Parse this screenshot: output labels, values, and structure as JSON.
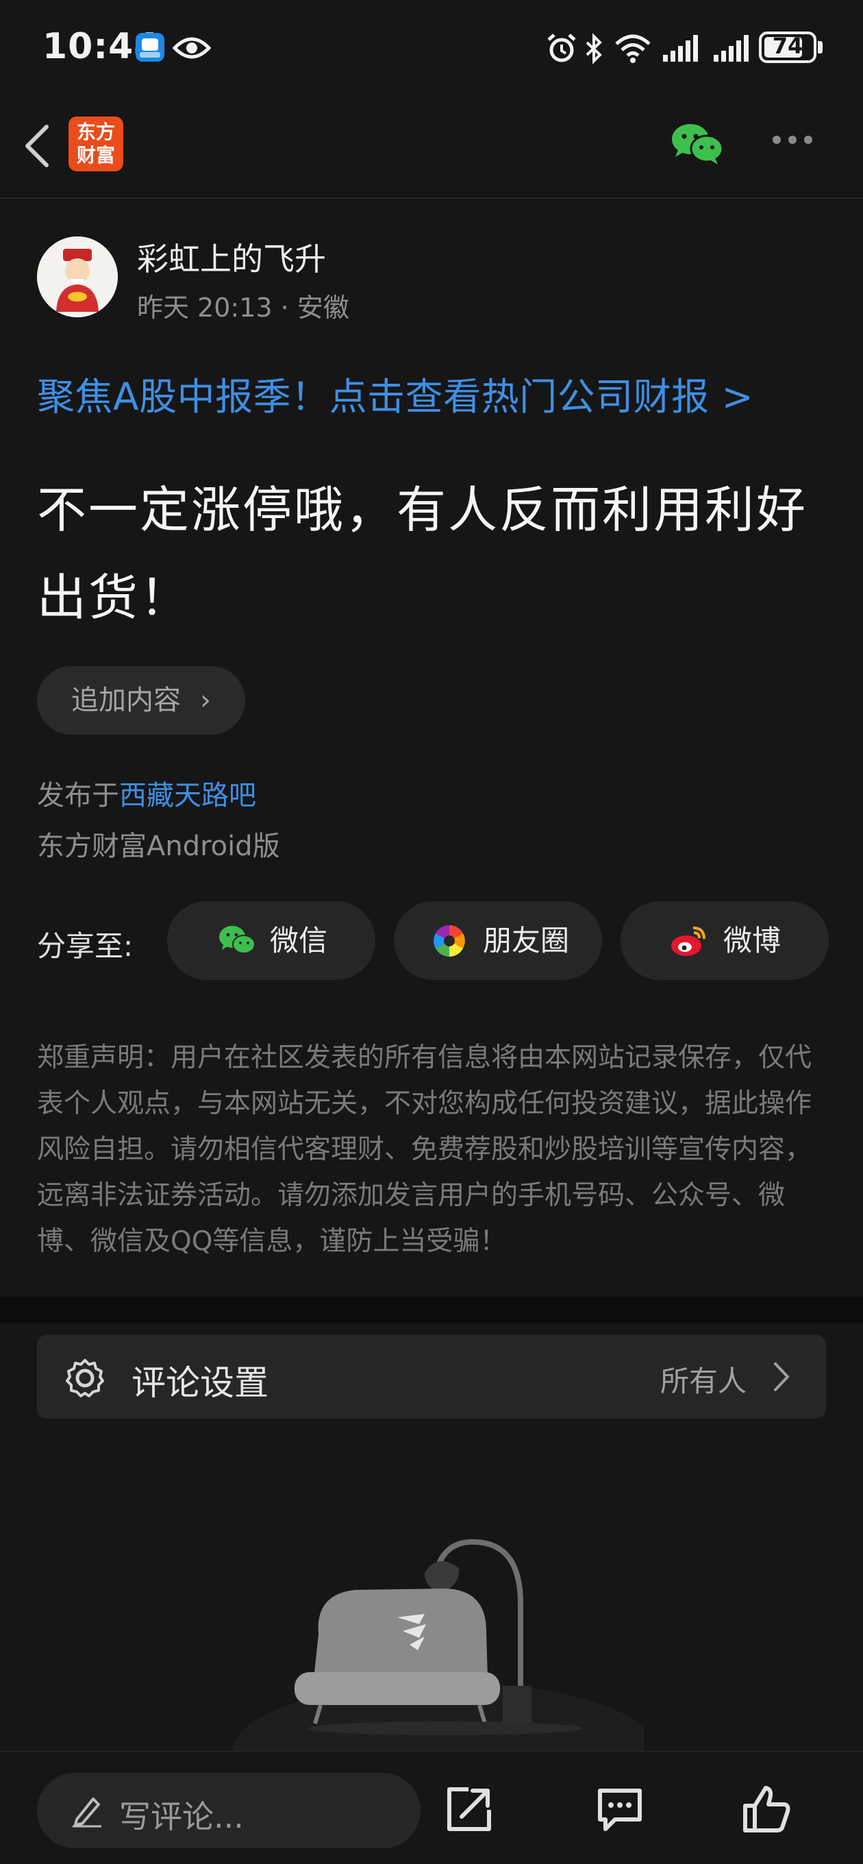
{
  "status_bar": {
    "time": "10:44",
    "battery": "74",
    "icons": [
      "app-notification-icon",
      "eye-icon",
      "alarm-icon",
      "bluetooth-icon",
      "wifi-icon",
      "signal-icon",
      "signal-icon",
      "battery-icon"
    ]
  },
  "nav": {
    "logo_line1": "东方",
    "logo_line2": "财富",
    "icons": [
      "back-icon",
      "wechat-icon",
      "more-icon"
    ]
  },
  "post": {
    "author": "彩虹上的飞升",
    "meta": "昨天 20:13 · 安徽",
    "promo": "聚焦A股中报季！点击查看热门公司财报 >",
    "title": "不一定涨停哦，有人反而利用利好出货！",
    "append_label": "追加内容",
    "published_prefix": "发布于",
    "forum": "西藏天路吧",
    "client": "东方财富Android版"
  },
  "share": {
    "label": "分享至:",
    "buttons": [
      {
        "label": "微信",
        "icon": "wechat-icon"
      },
      {
        "label": "朋友圈",
        "icon": "moments-icon"
      },
      {
        "label": "微博",
        "icon": "weibo-icon"
      }
    ]
  },
  "disclaimer": "郑重声明：用户在社区发表的所有信息将由本网站记录保存，仅代表个人观点，与本网站无关，不对您构成任何投资建议，据此操作风险自担。请勿相信代客理财、免费荐股和炒股培训等宣传内容，远离非法证券活动。请勿添加发言用户的手机号码、公众号、微博、微信及QQ等信息，谨防上当受骗！",
  "comment_settings": {
    "label": "评论设置",
    "value": "所有人"
  },
  "bottom_bar": {
    "placeholder": "写评论...",
    "icons": [
      "pencil-icon",
      "share-out-icon",
      "comment-icon",
      "like-icon"
    ]
  },
  "colors": {
    "background": "#161616",
    "link": "#3f8fe4",
    "logo": "#ea4c1b",
    "wechat": "#3dbf4e"
  }
}
